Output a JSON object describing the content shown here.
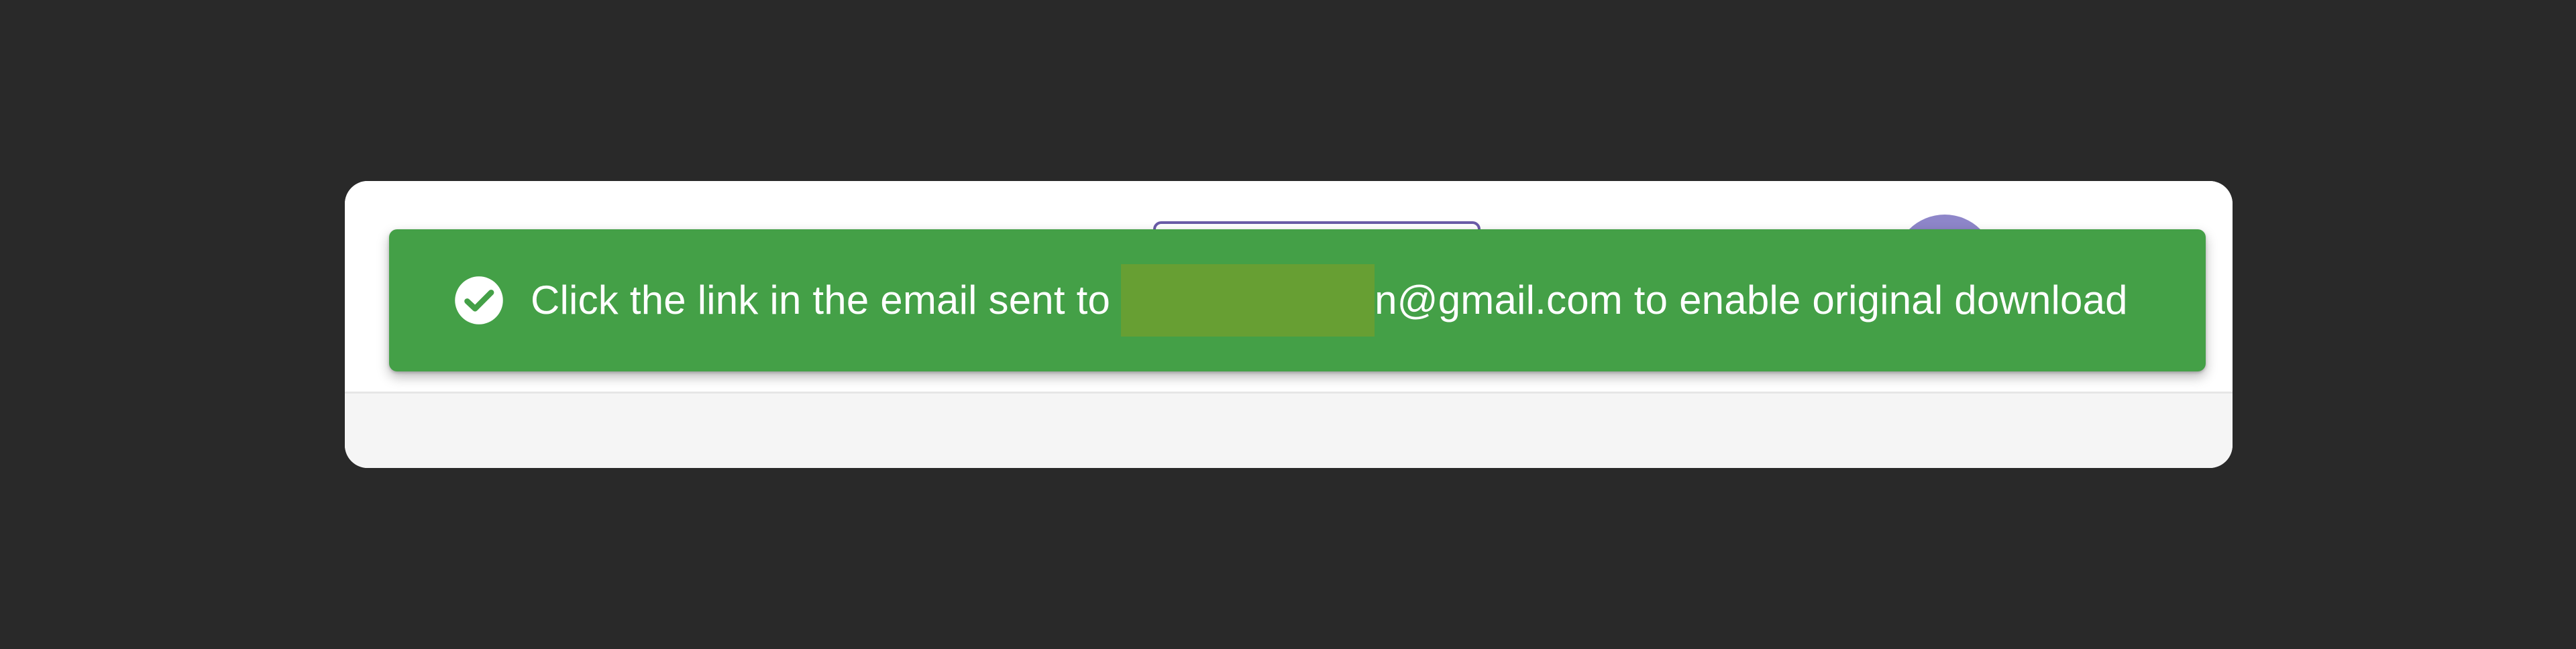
{
  "notification": {
    "type": "success",
    "icon": "check-circle-icon",
    "message_before": "Click the link in the email sent to",
    "redacted": "████████████",
    "message_after": "n@gmail.com to enable original download",
    "colors": {
      "background": "#44a047",
      "redaction": "#679f33",
      "text": "#ffffff"
    }
  },
  "page": {
    "background_color": "#292929"
  }
}
